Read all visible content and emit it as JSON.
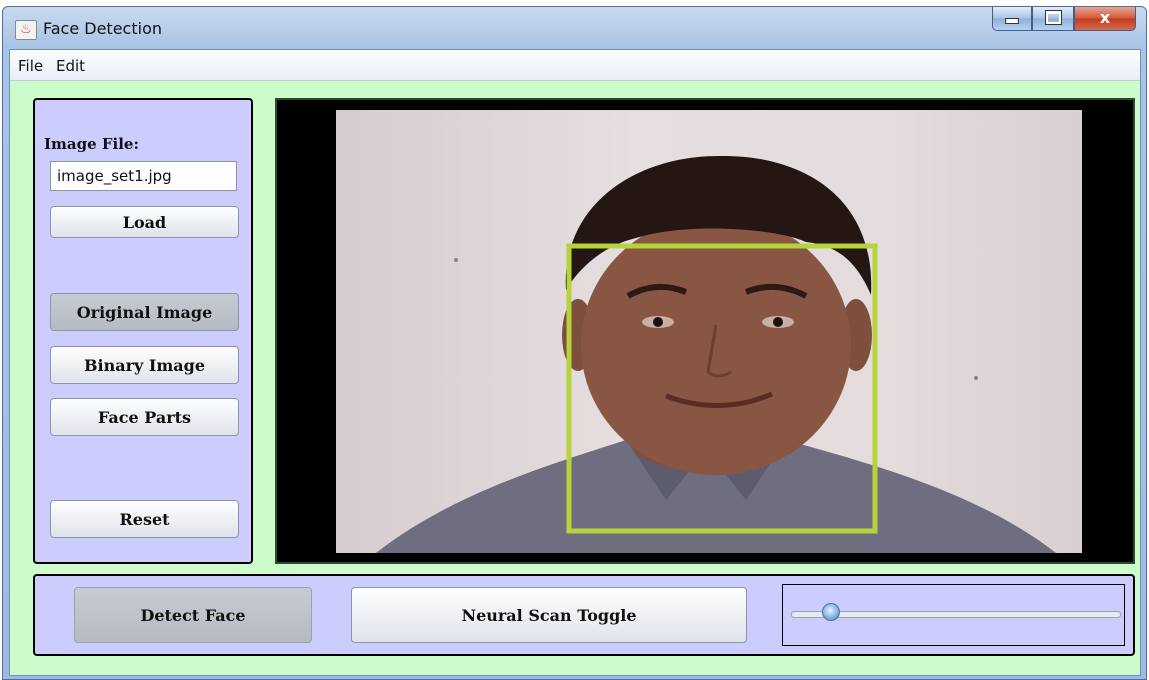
{
  "window": {
    "title": "Face Detection",
    "controls": {
      "minimize": "minimize",
      "maximize": "maximize",
      "close": "x"
    }
  },
  "menu": [
    "File",
    "Edit"
  ],
  "left_panel": {
    "image_file_label": "Image File:",
    "image_file_value": "image_set1.jpg",
    "load_label": "Load",
    "original_label": "Original Image",
    "binary_label": "Binary Image",
    "face_parts_label": "Face Parts",
    "reset_label": "Reset",
    "original_selected": true
  },
  "viewer": {
    "face_box_color": "#b5d33a",
    "face_detected": true
  },
  "bottom_panel": {
    "detect_label": "Detect Face",
    "neural_label": "Neural Scan Toggle",
    "detect_pressed": true,
    "slider_value": 0.12
  },
  "colors": {
    "client_bg": "#ccfccc",
    "panel_bg": "#ccccff",
    "accent": "#b5d33a"
  },
  "icons": [
    "java-app-icon",
    "minimize-icon",
    "maximize-icon",
    "close-icon"
  ]
}
